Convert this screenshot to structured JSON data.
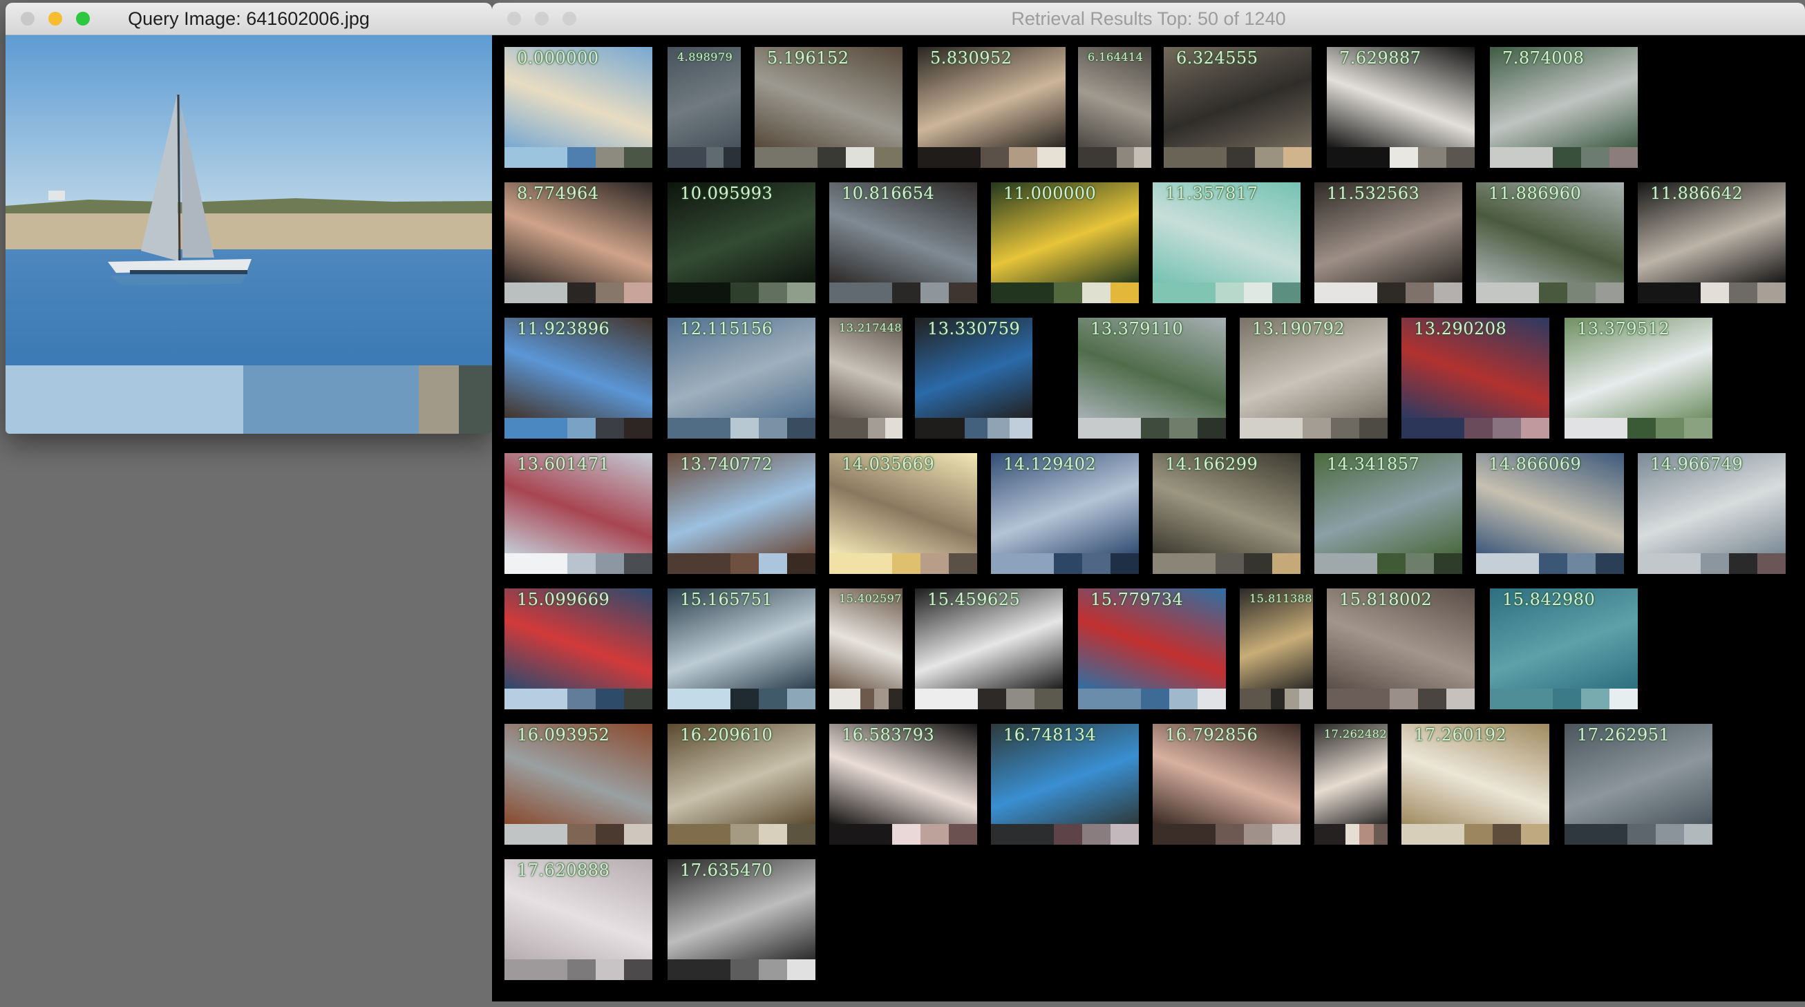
{
  "query_window": {
    "title": "Query Image: 641602006.jpg",
    "traffic_lights": [
      "#c8c8c8",
      "#f6be2e",
      "#2bc840"
    ],
    "palette": [
      "#a9c8df",
      "#6f9ac0",
      "#a29a88",
      "#4a5750"
    ]
  },
  "results_window": {
    "title": "Retrieval Results Top: 50 of 1240",
    "traffic_lights": [
      "#d0d0d0",
      "#d0d0d0",
      "#d0d0d0"
    ],
    "results": [
      {
        "score": "0.000000",
        "colors": [
          "#78a8d2",
          "#e8dcc2"
        ],
        "palette": [
          "#9cc4df",
          "#4f7fae",
          "#8d8a80",
          "#4b5647"
        ]
      },
      {
        "score": "4.898979",
        "colors": [
          "#47525c",
          "#707a80"
        ],
        "palette": [
          "#3e4752",
          "#5f6a71",
          "#2a3138"
        ]
      },
      {
        "score": "5.196152",
        "colors": [
          "#57493b",
          "#9c9a90"
        ],
        "palette": [
          "#777569",
          "#3a3a34",
          "#e0e0da",
          "#7a7560"
        ]
      },
      {
        "score": "5.830952",
        "colors": [
          "#2a2622",
          "#cdb59a"
        ],
        "palette": [
          "#1f1c19",
          "#5c5148",
          "#b19b85",
          "#e7e1d5"
        ]
      },
      {
        "score": "6.164414",
        "colors": [
          "#4c4842",
          "#a09a8f"
        ],
        "palette": [
          "#3d3a36",
          "#8d877e",
          "#c4beb4"
        ]
      },
      {
        "score": "6.324555",
        "colors": [
          "#726a5b",
          "#2f2d2a"
        ],
        "palette": [
          "#6a6457",
          "#3b3833",
          "#9c9280",
          "#cfb48d"
        ]
      },
      {
        "score": "7.629887",
        "colors": [
          "#141414",
          "#e3e0da"
        ],
        "palette": [
          "#131313",
          "#e9e7e1",
          "#86827a",
          "#5c5650"
        ]
      },
      {
        "score": "7.874008",
        "colors": [
          "#3f5c44",
          "#bfc4c2"
        ],
        "palette": [
          "#c9cbc9",
          "#39503d",
          "#6d7c70",
          "#8b7d7c"
        ]
      },
      {
        "score": "8.774964",
        "colors": [
          "#2a2523",
          "#cfa389"
        ],
        "palette": [
          "#b9c0bf",
          "#2a2624",
          "#86776a",
          "#c9a49b"
        ]
      },
      {
        "score": "10.095993",
        "colors": [
          "#0d140d",
          "#344b33"
        ],
        "palette": [
          "#0d130d",
          "#2e402c",
          "#61705f",
          "#8f9e8a"
        ]
      },
      {
        "score": "10.816654",
        "colors": [
          "#2e2a28",
          "#7e8a94"
        ],
        "palette": [
          "#606a70",
          "#2a2826",
          "#8e959b",
          "#3e3430"
        ]
      },
      {
        "score": "11.000000",
        "colors": [
          "#23381f",
          "#e7c43a"
        ],
        "palette": [
          "#22361f",
          "#52683d",
          "#dfe0cf",
          "#e2b73a"
        ]
      },
      {
        "score": "11.357817",
        "colors": [
          "#74c2b2",
          "#c7ded8"
        ],
        "palette": [
          "#7fc5b2",
          "#b8d8cc",
          "#dfe8e3",
          "#5d8f80"
        ]
      },
      {
        "score": "11.532563",
        "colors": [
          "#2f2a26",
          "#9d8f86"
        ],
        "palette": [
          "#e6e4e2",
          "#2e2a26",
          "#7e726a",
          "#b3b0ad"
        ]
      },
      {
        "score": "11.886960",
        "colors": [
          "#a9b2b2",
          "#4a5a3d"
        ],
        "palette": [
          "#c3c6c3",
          "#49593d",
          "#7a8477",
          "#999c96"
        ]
      },
      {
        "score": "11.886642",
        "colors": [
          "#171717",
          "#bdb4a8"
        ],
        "palette": [
          "#151515",
          "#e3ded7",
          "#6e6a66",
          "#a89f96"
        ]
      },
      {
        "score": "11.923896",
        "colors": [
          "#43342a",
          "#5b96d6"
        ],
        "palette": [
          "#4b87c1",
          "#79a2c4",
          "#3b3f45",
          "#2e2622"
        ]
      },
      {
        "score": "12.115156",
        "colors": [
          "#506f8e",
          "#9fb0bd"
        ],
        "palette": [
          "#516c85",
          "#b8c8d3",
          "#7a91a6",
          "#3a4d60"
        ]
      },
      {
        "score": "13.217448",
        "colors": [
          "#5a5048",
          "#c9c2b8"
        ],
        "palette": [
          "#5c564f",
          "#a39d95",
          "#e2ded7"
        ]
      },
      {
        "score": "13.330759",
        "colors": [
          "#222120",
          "#2b6aa9"
        ],
        "palette": [
          "#1e1d1c",
          "#43607c",
          "#8fa3b5",
          "#c0cddb"
        ]
      },
      {
        "score": "13.379110",
        "colors": [
          "#a7b0b4",
          "#4f6d4a"
        ],
        "palette": [
          "#c8cbcc",
          "#3f4b3c",
          "#6f7d6a",
          "#2c332a"
        ]
      },
      {
        "score": "13.190792",
        "colors": [
          "#7a7266",
          "#c9c4ba"
        ],
        "palette": [
          "#d3d0ca",
          "#a39d93",
          "#6f6a61",
          "#4e4a44"
        ]
      },
      {
        "score": "13.290208",
        "colors": [
          "#2c3a62",
          "#b2322f"
        ],
        "palette": [
          "#2b3658",
          "#6a4b5c",
          "#8a7380",
          "#c0999e"
        ]
      },
      {
        "score": "13.379512",
        "colors": [
          "#6f8f62",
          "#e6ebec"
        ],
        "palette": [
          "#e1e2e3",
          "#3a5a36",
          "#6d8a63",
          "#8aa27f"
        ]
      },
      {
        "score": "13.601471",
        "colors": [
          "#c4ccd6",
          "#a84552"
        ],
        "palette": [
          "#f1f2f4",
          "#b9c3cd",
          "#8d97a1",
          "#4a4d52"
        ]
      },
      {
        "score": "13.740772",
        "colors": [
          "#6a4b3c",
          "#9cc0e0"
        ],
        "palette": [
          "#4e3b31",
          "#6e5040",
          "#abc5dd",
          "#392a22"
        ]
      },
      {
        "score": "14.035669",
        "colors": [
          "#f3e8b6",
          "#8a7760"
        ],
        "palette": [
          "#f1e1a7",
          "#dfc06e",
          "#b89e88",
          "#5a5045"
        ]
      },
      {
        "score": "14.129402",
        "colors": [
          "#334d73",
          "#b4c4d6"
        ],
        "palette": [
          "#8da2bc",
          "#2e4666",
          "#4f6684",
          "#1f2f45"
        ]
      },
      {
        "score": "14.166299",
        "colors": [
          "#3c3a30",
          "#9c9680"
        ],
        "palette": [
          "#8a8577",
          "#5c5a52",
          "#36342e",
          "#c6a979"
        ]
      },
      {
        "score": "14.341857",
        "colors": [
          "#4b6a3e",
          "#8a9fa6"
        ],
        "palette": [
          "#9fa9ab",
          "#3f5a35",
          "#6d7e6b",
          "#2e3d2a"
        ]
      },
      {
        "score": "14.866069",
        "colors": [
          "#3e5a7b",
          "#c6c0b0"
        ],
        "palette": [
          "#c4cfd7",
          "#3c5776",
          "#6e879f",
          "#2a3e56"
        ]
      },
      {
        "score": "14.966749",
        "colors": [
          "#7b8a96",
          "#d8dcdc"
        ],
        "palette": [
          "#c2c7cb",
          "#8b969e",
          "#2a2a2a",
          "#6a5656"
        ]
      },
      {
        "score": "15.099669",
        "colors": [
          "#2b4a6e",
          "#d23a3a"
        ],
        "palette": [
          "#b6cde2",
          "#617d99",
          "#2f4b6a",
          "#3b3f3a"
        ]
      },
      {
        "score": "15.165751",
        "colors": [
          "#2a3d4a",
          "#bccbd4"
        ],
        "palette": [
          "#c3dbe9",
          "#1f2a31",
          "#405a6a",
          "#8ca7b8"
        ]
      },
      {
        "score": "15.402597",
        "colors": [
          "#6a5648",
          "#e6e3dd"
        ],
        "palette": [
          "#e8e6e1",
          "#6d5a4d",
          "#a3968a",
          "#2e2824"
        ]
      },
      {
        "score": "15.459625",
        "colors": [
          "#1e1e1e",
          "#e6e6e6"
        ],
        "palette": [
          "#ededee",
          "#2e2a27",
          "#8f8c86",
          "#5c5a4f"
        ]
      },
      {
        "score": "15.779734",
        "colors": [
          "#2f6fa3",
          "#c23030"
        ],
        "palette": [
          "#6a8dab",
          "#3d6b96",
          "#9fb8cc",
          "#e1e3e6"
        ]
      },
      {
        "score": "15.811388",
        "colors": [
          "#2b2a28",
          "#c8ad78"
        ],
        "palette": [
          "#5e564a",
          "#2b2926",
          "#a39d90",
          "#c5c2bd"
        ]
      },
      {
        "score": "15.818002",
        "colors": [
          "#5a4e48",
          "#a2968c"
        ],
        "palette": [
          "#6b5e58",
          "#9b9089",
          "#4a4540",
          "#c7c1bd"
        ]
      },
      {
        "score": "15.842980",
        "colors": [
          "#2d6e80",
          "#5ea1a8"
        ],
        "palette": [
          "#4f8e96",
          "#3b7b88",
          "#78abb0",
          "#e6eeef"
        ]
      },
      {
        "score": "16.093952",
        "colors": [
          "#8a4a2e",
          "#9aa0a2"
        ],
        "palette": [
          "#c1c4c5",
          "#7f6553",
          "#4a3a30",
          "#cfc7bd"
        ]
      },
      {
        "score": "16.209610",
        "colors": [
          "#5a4a30",
          "#c8c0aa"
        ],
        "palette": [
          "#7f6d4c",
          "#a59b83",
          "#d8d0bd",
          "#5d5440"
        ]
      },
      {
        "score": "16.583793",
        "colors": [
          "#141414",
          "#eadcd6"
        ],
        "palette": [
          "#1a1718",
          "#ead8d8",
          "#bda29c",
          "#6b5150"
        ]
      },
      {
        "score": "16.748134",
        "colors": [
          "#2e3a3a",
          "#3a8fd2"
        ],
        "palette": [
          "#2b2d2e",
          "#5e4348",
          "#8a7d80",
          "#c3b8bc"
        ]
      },
      {
        "score": "16.792856",
        "colors": [
          "#3a2a24",
          "#d8b0a0"
        ],
        "palette": [
          "#3b2d28",
          "#6d5951",
          "#a0918b",
          "#d2c8c4"
        ]
      },
      {
        "score": "17.262482",
        "colors": [
          "#2a2a2a",
          "#e8dcd0"
        ],
        "palette": [
          "#242120",
          "#e6ddd3",
          "#b38d80",
          "#6a5a52"
        ]
      },
      {
        "score": "17.260192",
        "colors": [
          "#a08a60",
          "#ece6d8"
        ],
        "palette": [
          "#d8cfba",
          "#9c8660",
          "#5e4d3a",
          "#bfa981"
        ]
      },
      {
        "score": "17.262951",
        "colors": [
          "#4a555e",
          "#8c969c"
        ],
        "palette": [
          "#2f383f",
          "#5c666c",
          "#8b949a",
          "#b2b9bd"
        ]
      },
      {
        "score": "17.620888",
        "colors": [
          "#b5adb0",
          "#e6e0e3"
        ],
        "palette": [
          "#9e9a9c",
          "#7d7a7c",
          "#c8c4c6",
          "#4d4a4c"
        ]
      },
      {
        "score": "17.635470",
        "colors": [
          "#2a2a2a",
          "#bdbdbd"
        ],
        "palette": [
          "#2a2a2a",
          "#5d5d5d",
          "#9a9a9a",
          "#e1e1e1"
        ]
      }
    ]
  }
}
